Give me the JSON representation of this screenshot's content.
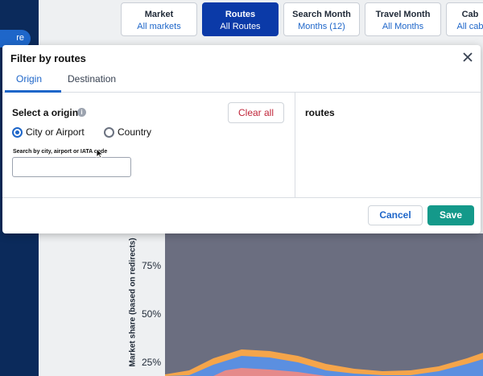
{
  "sidebar": {
    "partial_label": "re"
  },
  "filters": [
    {
      "title": "Market",
      "value": "All markets",
      "active": false
    },
    {
      "title": "Routes",
      "value": "All Routes",
      "active": true
    },
    {
      "title": "Search Month",
      "value": "Months (12)",
      "active": false
    },
    {
      "title": "Travel Month",
      "value": "All Months",
      "active": false
    },
    {
      "title": "Cab",
      "value": "All cab",
      "active": false
    }
  ],
  "chart": {
    "ylabel": "Market share (based on redirects)",
    "ticks": [
      "75%",
      "50%",
      "25%"
    ],
    "colors": {
      "background": "#6b6e80",
      "orange": "#f5a54a",
      "blue": "#5b8fe0",
      "pink": "#e58a8a"
    }
  },
  "modal": {
    "title": "Filter by routes",
    "tabs": {
      "origin": "Origin",
      "destination": "Destination"
    },
    "left": {
      "title": "Select a origin",
      "clear_label": "Clear all",
      "radio_city": "City or Airport",
      "radio_country": "Country",
      "search_label": "Search by city, airport or IATA code",
      "search_value": "",
      "search_placeholder": ""
    },
    "right": {
      "title": "routes"
    },
    "cancel_label": "Cancel",
    "save_label": "Save"
  },
  "colors": {
    "accent": "#1e66c9",
    "save": "#14998a",
    "clear": "#c0263a",
    "nav": "#0b2a5b"
  }
}
